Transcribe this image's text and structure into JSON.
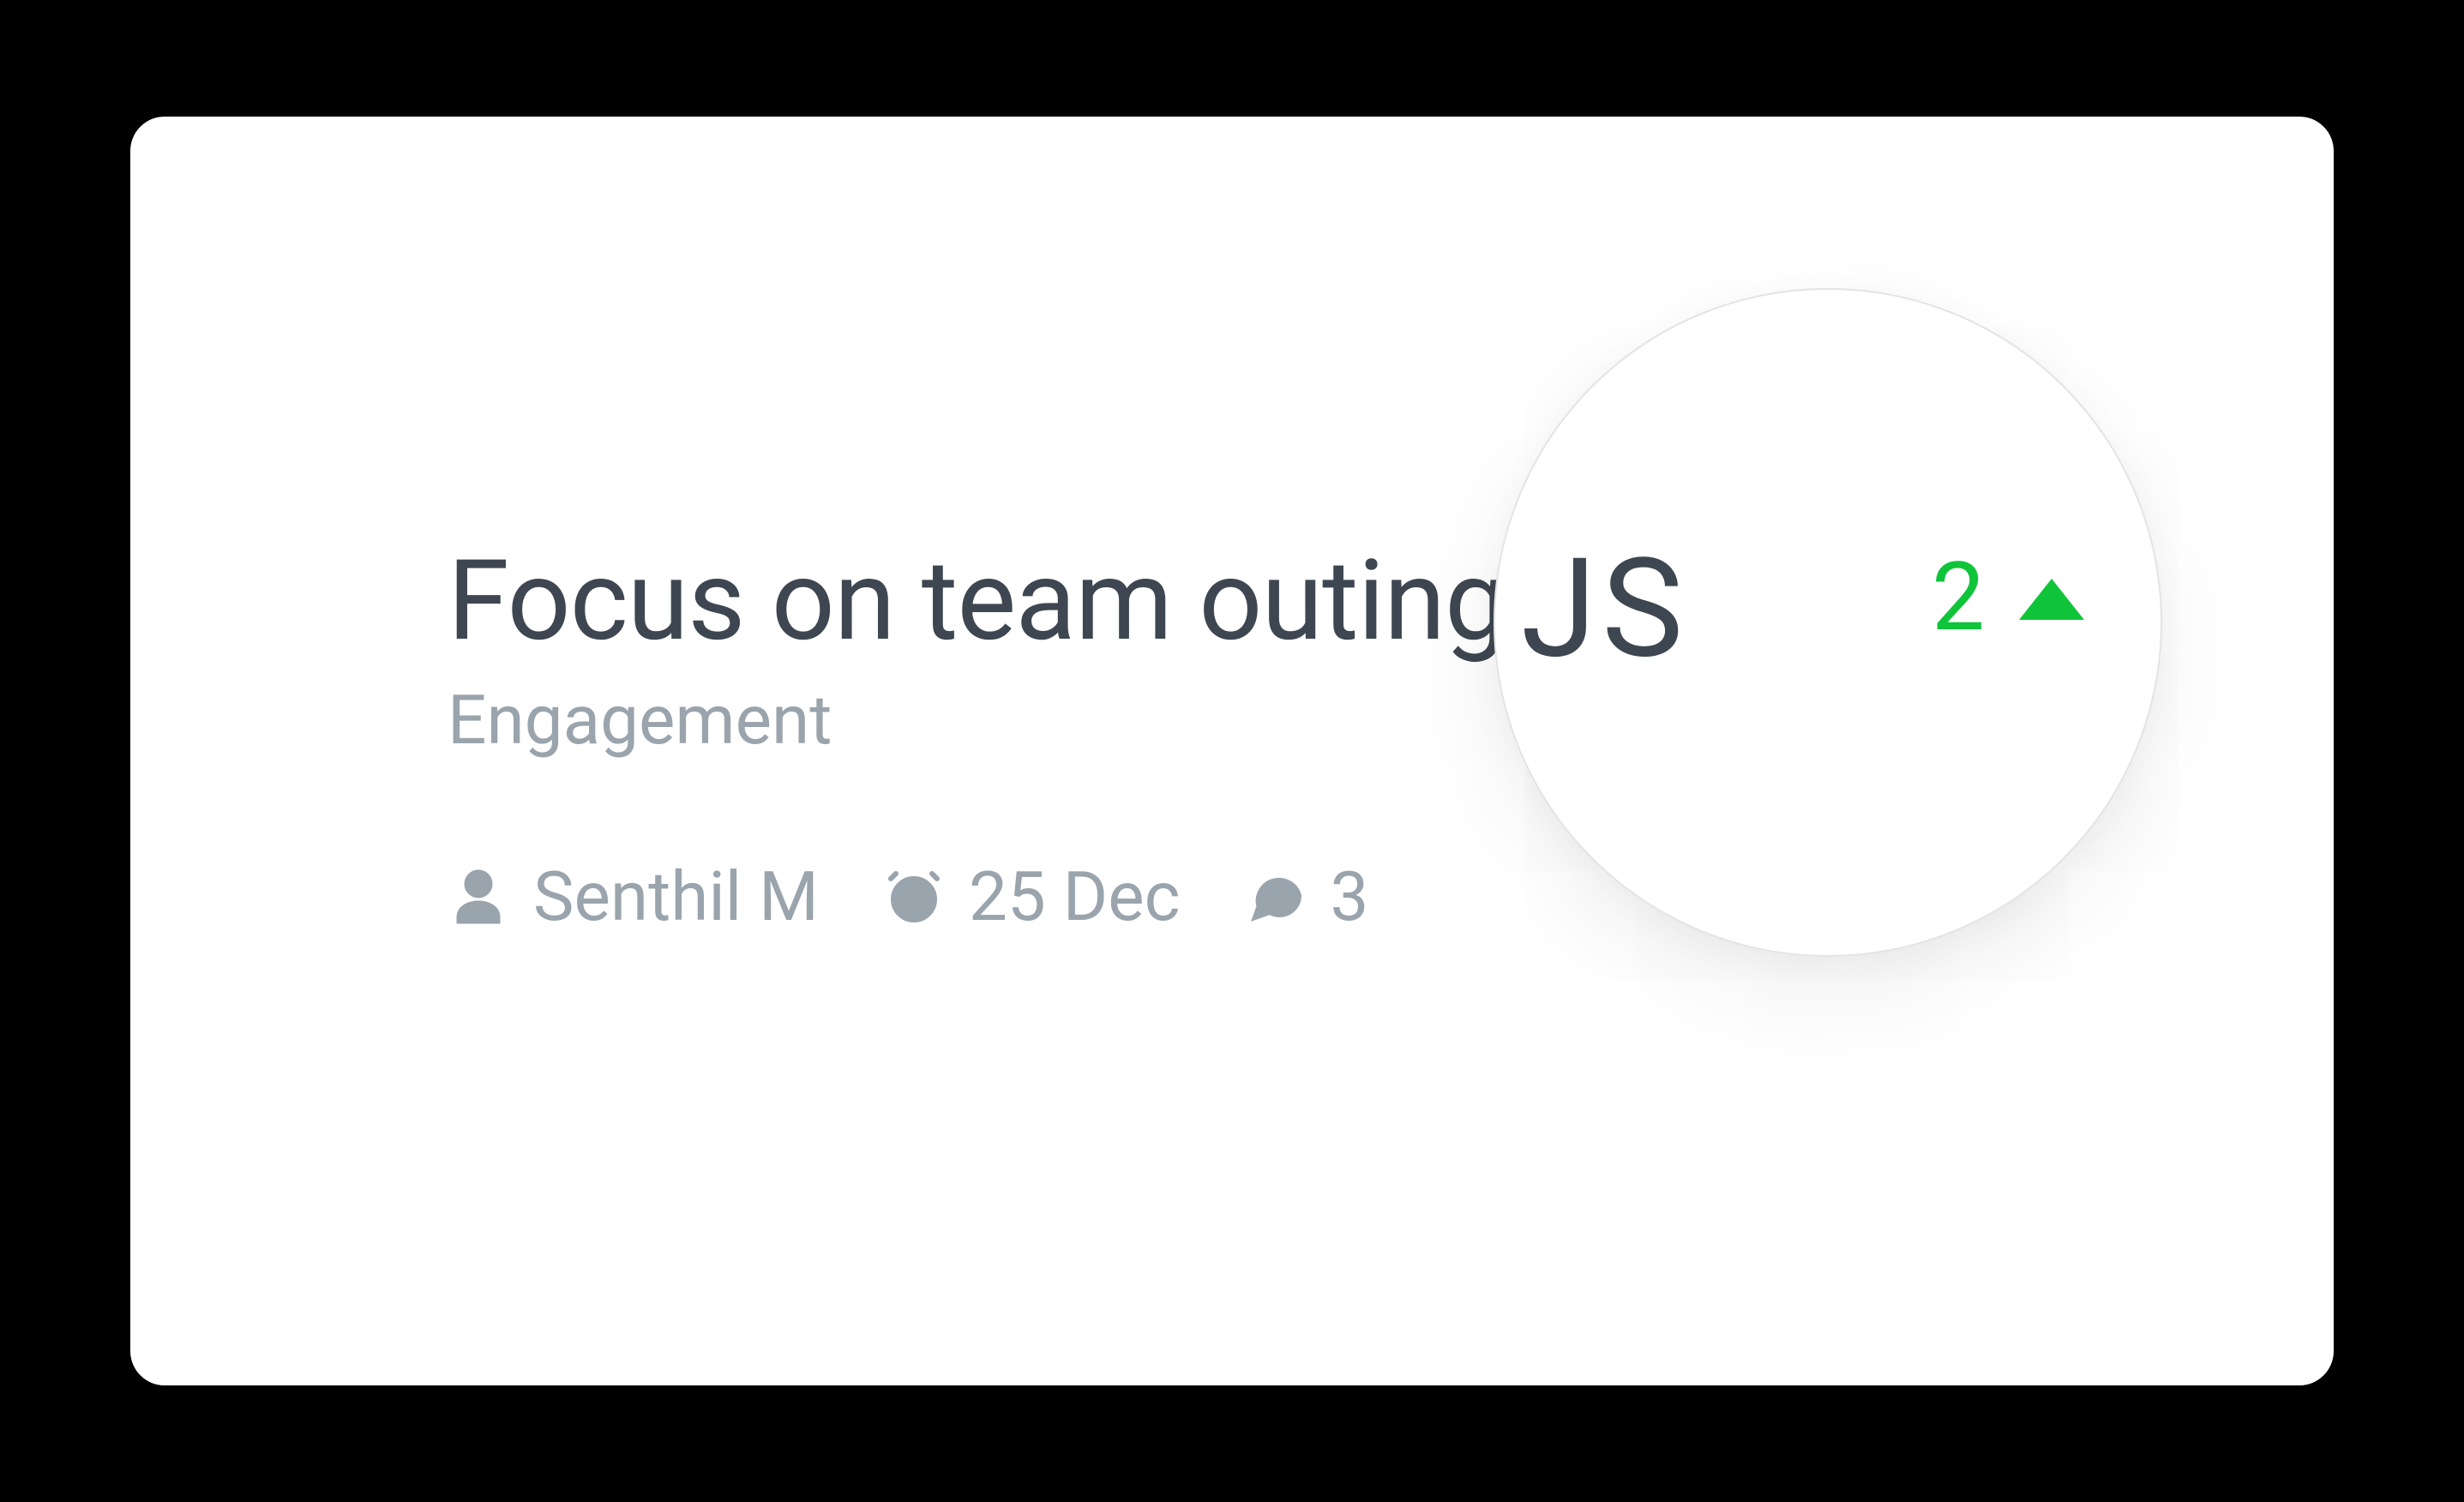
{
  "card": {
    "title": "Focus on team outings",
    "category": "Engagement",
    "author": "Senthil M",
    "due_date": "25 Dec",
    "comment_count": "3"
  },
  "zoom": {
    "title_tail": "JS",
    "vote_count": "2"
  },
  "colors": {
    "accent_green": "#10c43a",
    "text_primary": "#3e4751",
    "text_muted": "#9aa4ad"
  }
}
